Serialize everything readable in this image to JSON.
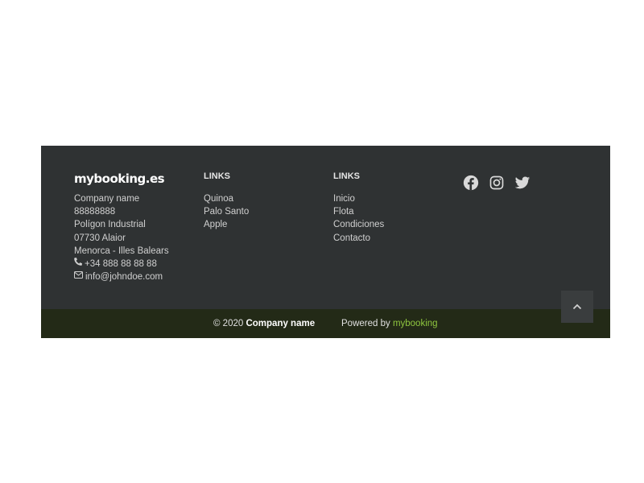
{
  "footer": {
    "logo": "mybooking.es",
    "contact": {
      "company": "Company name",
      "phone_id": "88888888",
      "address_line1": "Polígon Industrial",
      "address_line2": "07730 Alaior",
      "address_line3": "Menorca - Illes Balears",
      "phone": "+34 888 88 88 88",
      "email": "info@johndoe.com"
    },
    "links1": {
      "title": "LINKS",
      "items": [
        "Quinoa",
        "Palo Santo",
        "Apple"
      ]
    },
    "links2": {
      "title": "LINKS",
      "items": [
        "Inicio",
        "Flota",
        "Condiciones",
        "Contacto"
      ]
    },
    "social": [
      "facebook-icon",
      "instagram-icon",
      "twitter-icon"
    ],
    "bottom": {
      "copyright_prefix": "© 2020",
      "copyright_company": "Company name",
      "powered_prefix": "Powered by",
      "powered_link": "mybooking"
    }
  },
  "colors": {
    "footer_bg": "#2f3233",
    "bottom_bg": "#232a17",
    "accent": "#8fc63f",
    "text": "#d0d0d0"
  }
}
